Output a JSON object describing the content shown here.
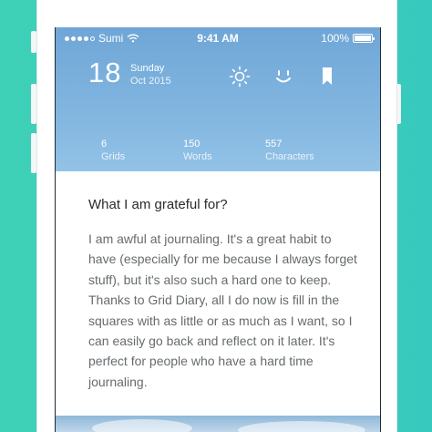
{
  "status_bar": {
    "carrier": "Sumi",
    "time": "9:41 AM",
    "battery": "100%"
  },
  "entry": {
    "day_number": "18",
    "weekday": "Sunday",
    "month_year": "Oct 2015"
  },
  "stats": [
    {
      "value": "6",
      "label": "Grids"
    },
    {
      "value": "150",
      "label": "Words"
    },
    {
      "value": "557",
      "label": "Characters"
    }
  ],
  "icons": {
    "weather": "sun-icon",
    "mood": "smile-icon",
    "bookmark": "bookmark-icon"
  },
  "content": {
    "question": "What I am grateful for?",
    "answer": "I am awful at journaling. It's a great habit to have (especially for me because I always forget stuff), but it's also such a hard one to keep. Thanks to Grid Diary, all I do now is fill in the squares with as little or as much as I want, so I can easily go back and reflect on it later. It's perfect for people who have a hard time journaling."
  },
  "colors": {
    "background": "#3fd1b7",
    "header": "#7ab0dc",
    "text": "#666b6e"
  }
}
